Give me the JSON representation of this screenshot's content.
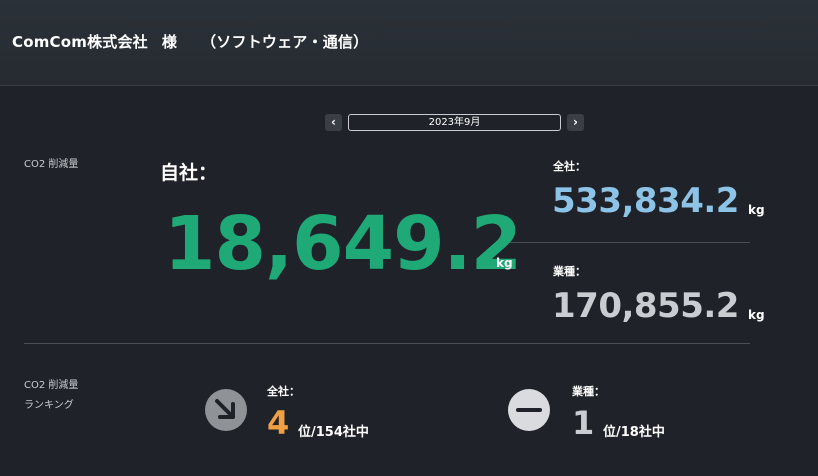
{
  "header": {
    "company": "ComCom株式会社",
    "honorific": "様",
    "industry": "（ソフトウェア・通信）"
  },
  "period": {
    "prev_icon": "chevron-left-icon",
    "month": "2023年9月",
    "next_icon": "chevron-right-icon"
  },
  "reduction": {
    "label": "CO2 削減量",
    "own_label": "自社：",
    "own_value": "18,649.2",
    "own_unit": "kg",
    "all_label": "全社：",
    "all_value": "533,834.2",
    "all_unit": "kg",
    "industry_label": "業種：",
    "industry_value": "170,855.2",
    "industry_unit": "kg"
  },
  "ranking": {
    "label_line1": "CO2 削減量",
    "label_line2": "ランキング",
    "all_label": "全社：",
    "all_rank": "4",
    "all_suffix": "位/154社中",
    "all_trend_icon": "arrow-down-right-icon",
    "industry_label": "業種：",
    "industry_rank": "1",
    "industry_suffix": "位/18社中",
    "industry_trend_icon": "minus-icon"
  },
  "colors": {
    "own_value": "#1fa977",
    "all_value": "#8cc3e6",
    "industry_value": "#c9ccd0",
    "rank_all": "#f0a043",
    "rank_industry": "#c9ccd0"
  }
}
